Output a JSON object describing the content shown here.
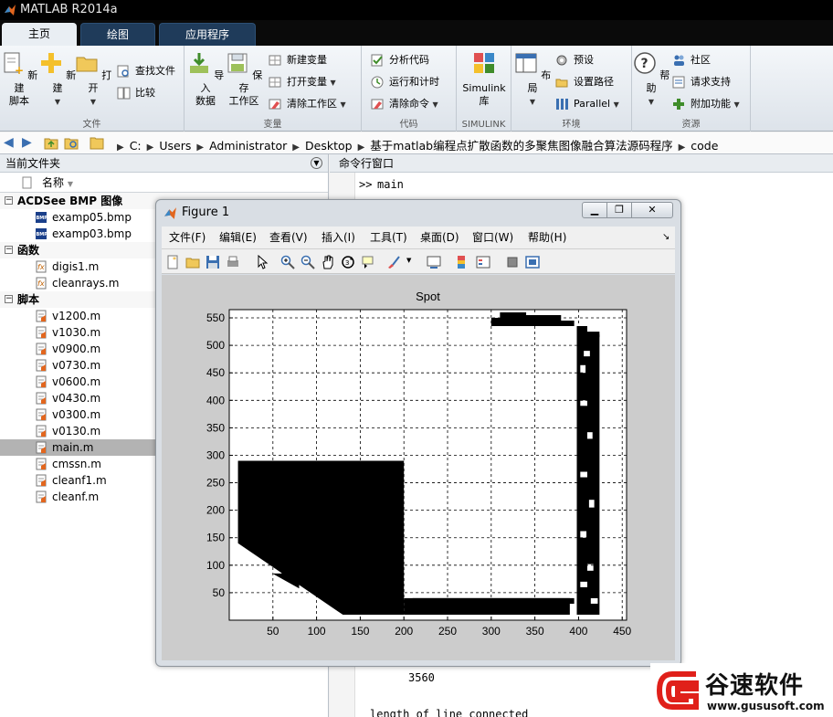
{
  "app": {
    "title": "MATLAB R2014a"
  },
  "tabs": [
    {
      "label": "主页",
      "active": true
    },
    {
      "label": "绘图",
      "active": false
    },
    {
      "label": "应用程序",
      "active": false
    }
  ],
  "ribbon": {
    "file": {
      "label": "文件",
      "new_script": "新建\n脚本",
      "new": "新建",
      "open": "打开",
      "find_files": "查找文件",
      "compare": "比较"
    },
    "variable": {
      "label": "变量",
      "import_data": "导入\n数据",
      "save_workspace": "保存\n工作区",
      "new_variable": "新建变量",
      "open_variable": "打开变量",
      "clear_workspace": "清除工作区"
    },
    "code": {
      "label": "代码",
      "analyze_code": "分析代码",
      "run_and_time": "运行和计时",
      "clear_commands": "清除命令"
    },
    "simulink": {
      "label": "SIMULINK",
      "library": "Simulink\n库"
    },
    "environment": {
      "label": "环境",
      "layout": "布局",
      "preferences": "预设",
      "set_path": "设置路径",
      "parallel": "Parallel"
    },
    "resources": {
      "label": "资源",
      "help": "帮助",
      "community": "社区",
      "request_support": "请求支持",
      "add_ons": "附加功能"
    }
  },
  "address": {
    "crumbs": [
      "C:",
      "Users",
      "Administrator",
      "Desktop",
      "基于matlab编程点扩散函数的多聚焦图像融合算法源码程序",
      "code"
    ]
  },
  "current_folder": {
    "title": "当前文件夹",
    "column_name": "名称",
    "sections": [
      {
        "label": "ACDSee BMP 图像",
        "items": [
          "examp05.bmp",
          "examp03.bmp"
        ]
      },
      {
        "label": "函数",
        "items": [
          "digis1.m",
          "cleanrays.m"
        ]
      },
      {
        "label": "脚本",
        "items": [
          "v1200.m",
          "v1030.m",
          "v0900.m",
          "v0730.m",
          "v0600.m",
          "v0430.m",
          "v0300.m",
          "v0130.m",
          "main.m",
          "cmssn.m",
          "cleanf1.m",
          "cleanf.m"
        ]
      }
    ],
    "selected": "main.m"
  },
  "command_window": {
    "title": "命令行窗口",
    "prompt": ">>",
    "command": "main",
    "output_value": "3560",
    "output_line": "length of line connected"
  },
  "figure": {
    "title": "Figure 1",
    "menu": [
      "文件(F)",
      "编辑(E)",
      "查看(V)",
      "插入(I)",
      "工具(T)",
      "桌面(D)",
      "窗口(W)",
      "帮助(H)"
    ],
    "window_buttons": [
      "minimize",
      "restore",
      "close"
    ]
  },
  "chart_data": {
    "type": "image",
    "title": "Spot",
    "xlabel": "",
    "ylabel": "",
    "xlim": [
      0,
      455
    ],
    "ylim": [
      0,
      565
    ],
    "xticks": [
      50,
      100,
      150,
      200,
      250,
      300,
      350,
      400,
      450
    ],
    "yticks": [
      50,
      100,
      150,
      200,
      250,
      300,
      350,
      400,
      450,
      500,
      550
    ],
    "grid": true,
    "grid_style": "dashed",
    "colors": {
      "foreground": "#000000",
      "background": "#ffffff"
    }
  },
  "watermark": {
    "brand": "谷速软件",
    "url": "www.gususoft.com"
  },
  "colors": {
    "tab_active": "#e9eef3",
    "tab_inactive": "#1f3b5a",
    "selection": "#b3b3b3"
  }
}
